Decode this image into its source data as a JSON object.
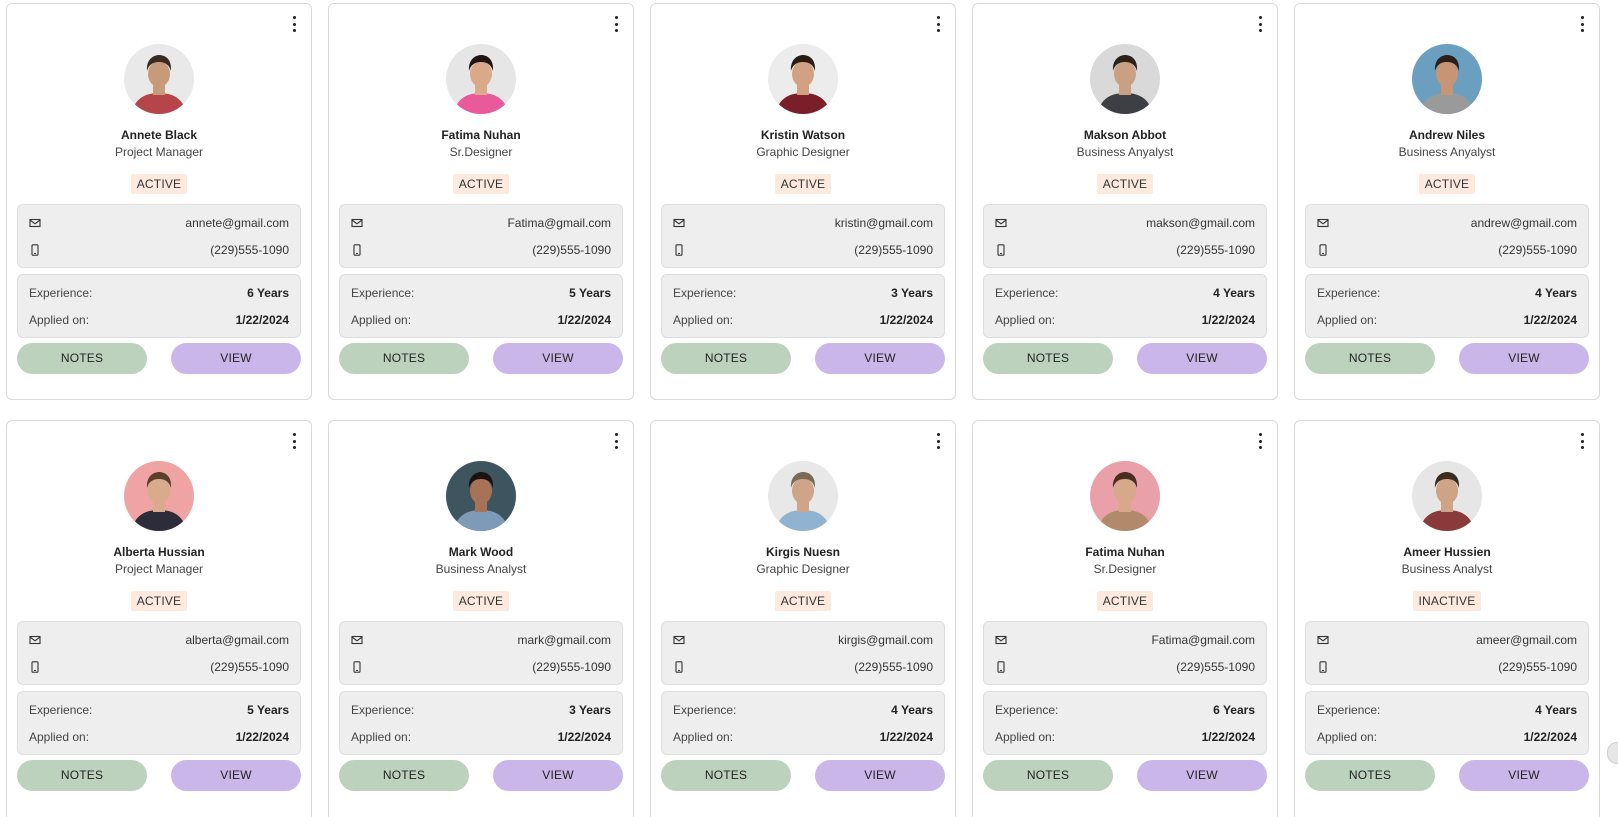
{
  "buttons": {
    "notes_label": "NOTES",
    "view_label": "VIEW"
  },
  "labels": {
    "experience": "Experience:",
    "applied_on": "Applied on:"
  },
  "icons": {
    "email": "mail-icon",
    "phone": "phone-icon",
    "menu": "kebab-menu-icon"
  },
  "colors": {
    "status_bg": "#fde9dd",
    "notes_button": "#bcd2bd",
    "view_button": "#cbb6ea",
    "info_box": "#eeeeee"
  },
  "candidates": [
    {
      "name": "Annete Black",
      "role": "Project Manager",
      "status": "ACTIVE",
      "email": "annete@gmail.com",
      "phone": "(229)555-1090",
      "experience": "6 Years",
      "applied_on": "1/22/2024",
      "avatar_bg": "#e9e9e9",
      "skin": "#c89a7c",
      "hair": "#3a2a20",
      "shirt": "#b5454a"
    },
    {
      "name": "Fatima Nuhan",
      "role": "Sr.Designer",
      "status": "ACTIVE",
      "email": "Fatima@gmail.com",
      "phone": "(229)555-1090",
      "experience": "5 Years",
      "applied_on": "1/22/2024",
      "avatar_bg": "#e6e6e6",
      "skin": "#d9a98a",
      "hair": "#1f1612",
      "shirt": "#e85a9a"
    },
    {
      "name": "Kristin Watson",
      "role": "Graphic Designer",
      "status": "ACTIVE",
      "email": "kristin@gmail.com",
      "phone": "(229)555-1090",
      "experience": "3 Years",
      "applied_on": "1/22/2024",
      "avatar_bg": "#ececec",
      "skin": "#d2a184",
      "hair": "#2a1c14",
      "shirt": "#7a1f2a"
    },
    {
      "name": "Makson Abbot",
      "role": "Business Anyalyst",
      "status": "ACTIVE",
      "email": "makson@gmail.com",
      "phone": "(229)555-1090",
      "experience": "4 Years",
      "applied_on": "1/22/2024",
      "avatar_bg": "#d9d9d9",
      "skin": "#c9a083",
      "hair": "#2b2119",
      "shirt": "#3d3f45"
    },
    {
      "name": "Andrew Niles",
      "role": "Business Anyalyst",
      "status": "ACTIVE",
      "email": "andrew@gmail.com",
      "phone": "(229)555-1090",
      "experience": "4 Years",
      "applied_on": "1/22/2024",
      "avatar_bg": "#6a9fc0",
      "skin": "#c79475",
      "hair": "#2a2019",
      "shirt": "#9a9a9a"
    },
    {
      "name": "Alberta Hussian",
      "role": "Project Manager",
      "status": "ACTIVE",
      "email": "alberta@gmail.com",
      "phone": "(229)555-1090",
      "experience": "5 Years",
      "applied_on": "1/22/2024",
      "avatar_bg": "#f0a3a3",
      "skin": "#d8ab8c",
      "hair": "#5a3f2a",
      "shirt": "#2c2c3a"
    },
    {
      "name": "Mark Wood",
      "role": "Business Analyst",
      "status": "ACTIVE",
      "email": "mark@gmail.com",
      "phone": "(229)555-1090",
      "experience": "3 Years",
      "applied_on": "1/22/2024",
      "avatar_bg": "#3e5560",
      "skin": "#a87256",
      "hair": "#1a1410",
      "shirt": "#7d9ab8"
    },
    {
      "name": "Kirgis Nuesn",
      "role": "Graphic Designer",
      "status": "ACTIVE",
      "email": "kirgis@gmail.com",
      "phone": "(229)555-1090",
      "experience": "4 Years",
      "applied_on": "1/22/2024",
      "avatar_bg": "#e8e8e8",
      "skin": "#d0a488",
      "hair": "#7a6a58",
      "shirt": "#8fb3d1"
    },
    {
      "name": "Fatima Nuhan",
      "role": "Sr.Designer",
      "status": "ACTIVE",
      "email": "Fatima@gmail.com",
      "phone": "(229)555-1090",
      "experience": "6 Years",
      "applied_on": "1/22/2024",
      "avatar_bg": "#e9a0a8",
      "skin": "#d7a889",
      "hair": "#4a2e20",
      "shirt": "#b08a6a"
    },
    {
      "name": "Ameer Hussien",
      "role": "Business Analyst",
      "status": "INACTIVE",
      "email": "ameer@gmail.com",
      "phone": "(229)555-1090",
      "experience": "4 Years",
      "applied_on": "1/22/2024",
      "avatar_bg": "#e6e6e6",
      "skin": "#cfa386",
      "hair": "#3b2c20",
      "shirt": "#8a3a3a"
    }
  ]
}
